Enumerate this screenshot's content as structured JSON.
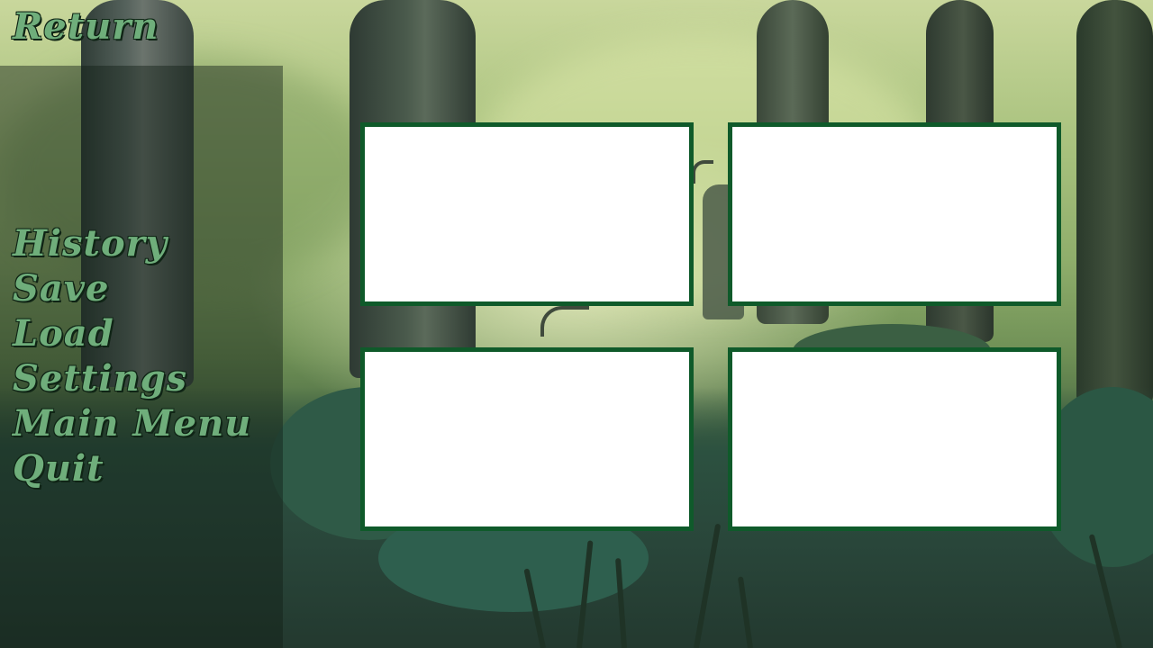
{
  "header": {
    "return_label": "Return"
  },
  "menu": {
    "items": [
      {
        "id": "history",
        "label": "History"
      },
      {
        "id": "save",
        "label": "Save"
      },
      {
        "id": "load",
        "label": "Load"
      },
      {
        "id": "settings",
        "label": "Settings"
      },
      {
        "id": "main-menu",
        "label": "Main Menu"
      },
      {
        "id": "quit",
        "label": "Quit"
      }
    ]
  },
  "slots": [
    {
      "filled": false
    },
    {
      "filled": false
    },
    {
      "filled": false
    },
    {
      "filled": false
    }
  ],
  "colors": {
    "menu_text": "#6fae7b",
    "slot_border": "#0f5a2a",
    "slot_fill": "#ffffff",
    "panel_overlay": "#122016"
  }
}
